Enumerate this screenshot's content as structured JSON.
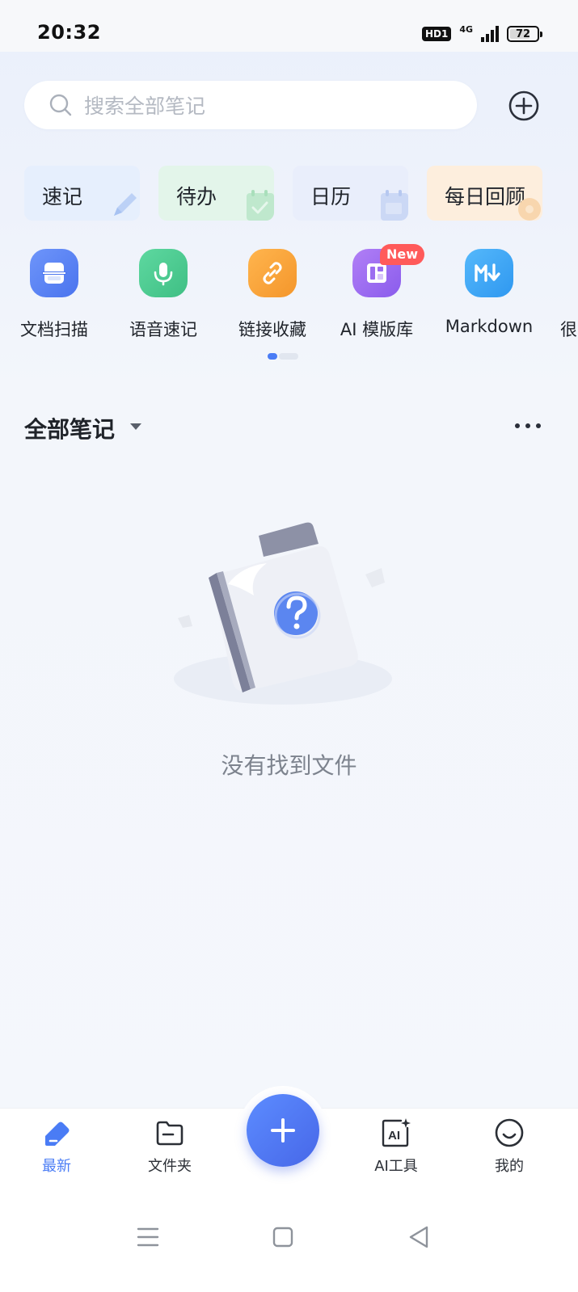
{
  "status_bar": {
    "time": "20:32",
    "hd_label": "HD1",
    "network": "4G",
    "battery": "72"
  },
  "search": {
    "placeholder": "搜索全部笔记"
  },
  "quick_cards": [
    {
      "label": "速记",
      "color": "#e6effd"
    },
    {
      "label": "待办",
      "color": "#e3f5ea"
    },
    {
      "label": "日历",
      "color": "#e9eefb"
    },
    {
      "label": "每日回顾",
      "color": "#fdeedd"
    }
  ],
  "tools": [
    {
      "label": "文档扫描",
      "icon": "scan-icon",
      "color": "#5b85f5"
    },
    {
      "label": "语音速记",
      "icon": "microphone-icon",
      "color": "#47c98c"
    },
    {
      "label": "链接收藏",
      "icon": "link-icon",
      "color": "#f7a23a"
    },
    {
      "label": "AI 模版库",
      "icon": "template-icon",
      "color": "#9d6cf2",
      "badge": "New"
    },
    {
      "label": "Markdown",
      "icon": "markdown-icon",
      "color": "#3aa6f6"
    },
    {
      "label": "很",
      "icon": "partial-tool-icon",
      "color": "#7c8594"
    }
  ],
  "section": {
    "title": "全部笔记"
  },
  "empty_state": {
    "text": "没有找到文件"
  },
  "bottom_nav": {
    "items": [
      {
        "label": "最新",
        "icon": "latest-note-icon",
        "active": true
      },
      {
        "label": "文件夹",
        "icon": "folder-icon",
        "active": false
      },
      {
        "label": "AI工具",
        "icon": "ai-tools-icon",
        "active": false
      },
      {
        "label": "我的",
        "icon": "profile-icon",
        "active": false
      }
    ]
  },
  "colors": {
    "accent": "#4a7cf5",
    "badge": "#ff5a5a"
  }
}
